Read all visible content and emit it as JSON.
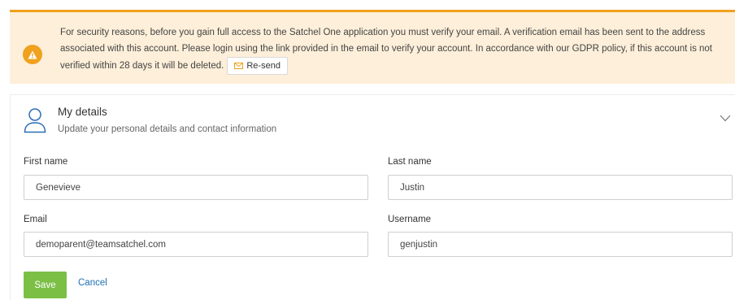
{
  "banner": {
    "message": "For security reasons, before you gain full access to the Satchel One application you must verify your email. A verification email has been sent to the address associated with this account. Please login using the link provided in the email to verify your account. In accordance with our GDPR policy, if this account is not verified within 28 days it will be deleted.",
    "resend_label": "Re-send",
    "icon": "warning-icon",
    "accent_color": "#f0a11d",
    "background_color": "#fdefd9"
  },
  "details": {
    "title": "My details",
    "subtitle": "Update your personal details and contact information",
    "icon": "person-icon",
    "collapse_icon": "chevron-down-icon"
  },
  "form": {
    "first_name": {
      "label": "First name",
      "value": "Genevieve"
    },
    "last_name": {
      "label": "Last name",
      "value": "Justin"
    },
    "email": {
      "label": "Email",
      "value": "demoparent@teamsatchel.com"
    },
    "username": {
      "label": "Username",
      "value": "genjustin"
    },
    "save_label": "Save",
    "cancel_label": "Cancel",
    "save_color": "#7bbf45",
    "link_color": "#1c6fb5"
  }
}
